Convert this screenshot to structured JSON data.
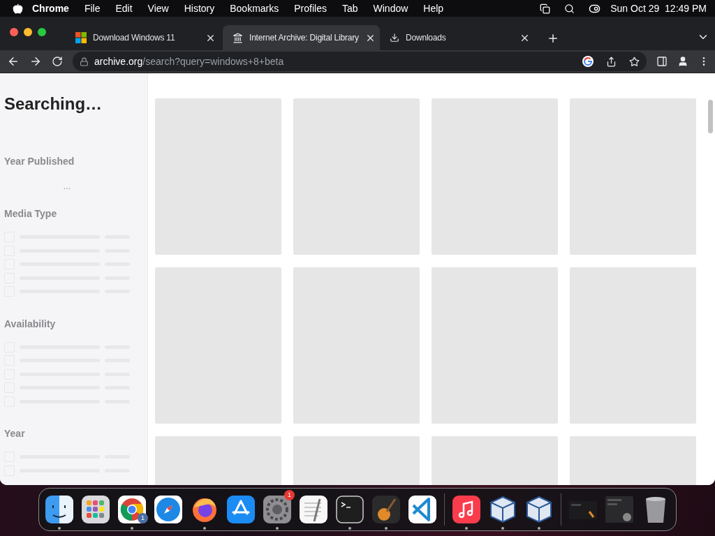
{
  "menu_bar": {
    "app": "Chrome",
    "items": [
      "File",
      "Edit",
      "View",
      "History",
      "Bookmarks",
      "Profiles",
      "Tab",
      "Window",
      "Help"
    ],
    "clock": "Sun Oct 29  12:49 PM"
  },
  "tabs": [
    {
      "kind": "windows",
      "title": "Download Windows 11",
      "selected": false
    },
    {
      "kind": "archive",
      "title": "Internet Archive: Digital Library",
      "selected": true
    },
    {
      "kind": "download",
      "title": "Downloads",
      "selected": false
    }
  ],
  "address_bar": {
    "host": "archive.org",
    "path": "/search?query=windows+8+beta"
  },
  "sidebar": {
    "title": "Searching…",
    "facets": [
      {
        "kind": "histogram",
        "title": "Year Published",
        "loading": "..."
      },
      {
        "kind": "checklist",
        "title": "Media Type"
      },
      {
        "kind": "checklist",
        "title": "Availability"
      },
      {
        "kind": "checklist",
        "title": "Year"
      }
    ]
  },
  "dock": [
    {
      "kind": "finder",
      "running": true
    },
    {
      "kind": "launchpad",
      "running": false
    },
    {
      "kind": "chrome",
      "running": true,
      "badge": "1"
    },
    {
      "kind": "safari",
      "running": false
    },
    {
      "kind": "firefox",
      "running": true
    },
    {
      "kind": "appstore",
      "running": false
    },
    {
      "kind": "settings",
      "running": true,
      "badge": "1"
    },
    {
      "kind": "textedit",
      "running": false
    },
    {
      "kind": "terminal",
      "running": true
    },
    {
      "kind": "garageband",
      "running": true
    },
    {
      "kind": "vscode",
      "running": false
    },
    {
      "kind": "separator"
    },
    {
      "kind": "music",
      "running": true
    },
    {
      "kind": "virtualbox",
      "running": true
    },
    {
      "kind": "virtualbox",
      "running": true
    },
    {
      "kind": "separator"
    },
    {
      "kind": "window-thumb",
      "running": false
    },
    {
      "kind": "window-thumb-dark",
      "running": false
    },
    {
      "kind": "trash",
      "running": false
    }
  ]
}
